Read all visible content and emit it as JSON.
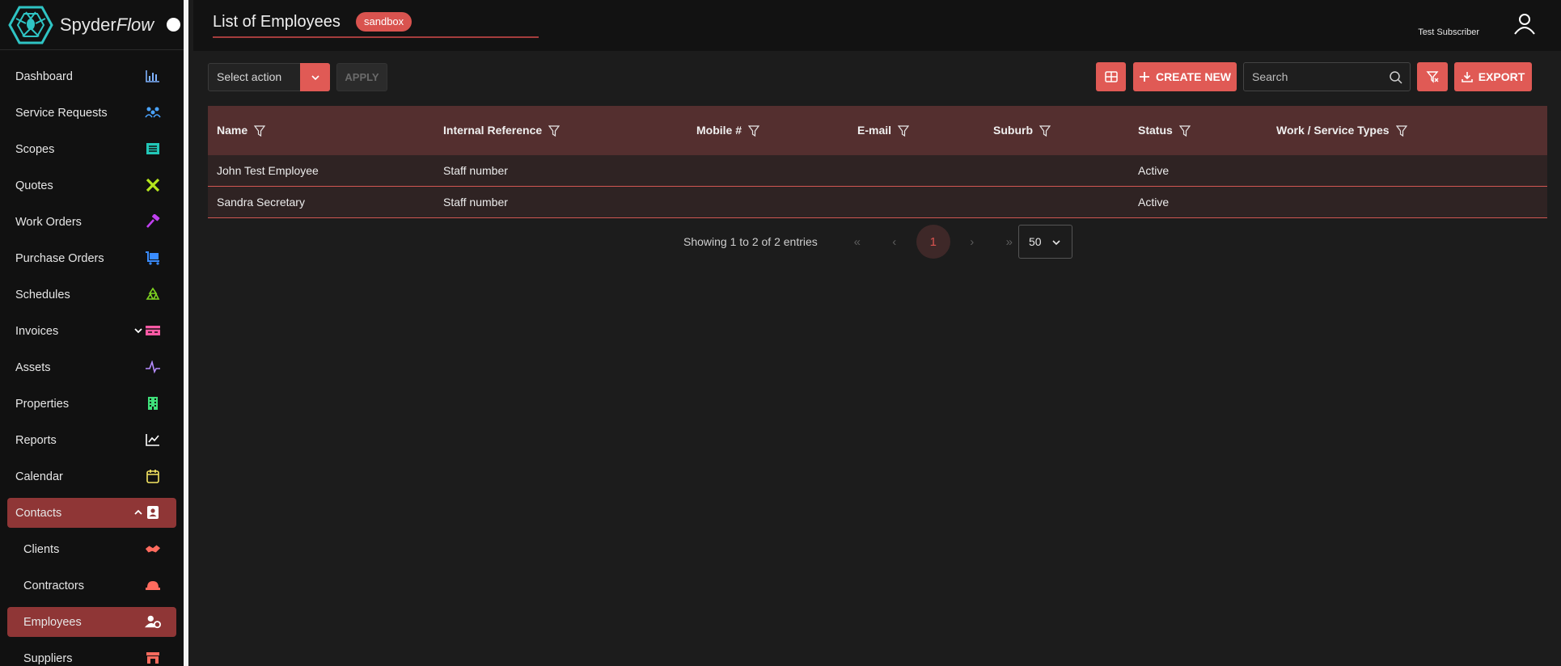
{
  "brand": {
    "name_main": "Spyder",
    "name_italic": "Flow"
  },
  "header": {
    "title": "List of Employees",
    "badge": "sandbox",
    "user_name": "Test Subscriber"
  },
  "sidebar": {
    "items": [
      {
        "label": "Dashboard",
        "icon": "bar-chart-icon",
        "color": "#7fb3ff"
      },
      {
        "label": "Service Requests",
        "icon": "team-icon",
        "color": "#4aa3ff"
      },
      {
        "label": "Scopes",
        "icon": "list-icon",
        "color": "#22c7b8"
      },
      {
        "label": "Quotes",
        "icon": "tools-icon",
        "color": "#b5e61d"
      },
      {
        "label": "Work Orders",
        "icon": "hammer-icon",
        "color": "#c040f0"
      },
      {
        "label": "Purchase Orders",
        "icon": "cart-icon",
        "color": "#3a8cff"
      },
      {
        "label": "Schedules",
        "icon": "recycle-icon",
        "color": "#7ed321"
      },
      {
        "label": "Invoices",
        "icon": "invoice-icon",
        "color": "#ff5aa5"
      },
      {
        "label": "Assets",
        "icon": "pulse-icon",
        "color": "#b58cff"
      },
      {
        "label": "Properties",
        "icon": "building-icon",
        "color": "#3fe07a"
      },
      {
        "label": "Reports",
        "icon": "line-chart-icon",
        "color": "#ffffff"
      },
      {
        "label": "Calendar",
        "icon": "calendar-icon",
        "color": "#f5e663"
      },
      {
        "label": "Contacts",
        "icon": "contact-card-icon",
        "color": "#ffffff"
      },
      {
        "label": "Clients",
        "icon": "handshake-icon",
        "color": "#ff6b5e"
      },
      {
        "label": "Contractors",
        "icon": "hardhat-icon",
        "color": "#ff6b5e"
      },
      {
        "label": "Employees",
        "icon": "user-settings-icon",
        "color": "#ffffff"
      },
      {
        "label": "Suppliers",
        "icon": "store-icon",
        "color": "#ff6b5e"
      }
    ]
  },
  "toolbar": {
    "select_action": "Select action",
    "apply_label": "APPLY",
    "create_label": "CREATE NEW",
    "search_placeholder": "Search",
    "export_label": "EXPORT"
  },
  "table": {
    "columns": [
      "Name",
      "Internal Reference",
      "Mobile #",
      "E-mail",
      "Suburb",
      "Status",
      "Work / Service Types"
    ],
    "rows": [
      [
        "John Test Employee",
        "Staff number",
        "",
        "",
        "",
        "Active",
        ""
      ],
      [
        "Sandra Secretary",
        "Staff number",
        "",
        "",
        "",
        "Active",
        ""
      ]
    ]
  },
  "pagination": {
    "info": "Showing 1 to 2 of 2 entries",
    "current_page": "1",
    "per_page": "50"
  },
  "colors": {
    "accent": "#e05a55",
    "header_row": "#542f2f",
    "row_bg": "#2f2323",
    "active_nav": "#8f3636"
  }
}
